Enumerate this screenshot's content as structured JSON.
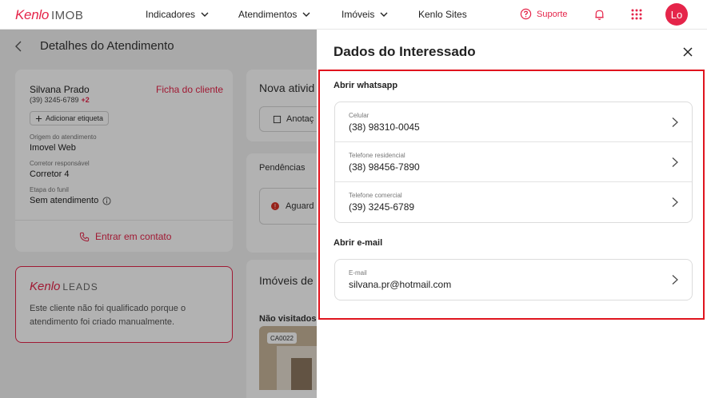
{
  "app": {
    "logo_brand": "Kenlo",
    "logo_suffix": "IMOB",
    "nav": [
      {
        "label": "Indicadores"
      },
      {
        "label": "Atendimentos"
      },
      {
        "label": "Imóveis"
      },
      {
        "label": "Kenlo Sites"
      }
    ],
    "support_label": "Suporte",
    "avatar_initials": "Lo",
    "accent_color": "#e5254a"
  },
  "background": {
    "page_title": "Detalhes do Atendimento",
    "client": {
      "name": "Silvana Prado",
      "phone": "(39) 3245-6789",
      "more_phones": "+2",
      "profile_link": "Ficha do cliente",
      "add_tag": "Adicionar etiqueta",
      "fields": [
        {
          "label": "Origem do atendimento",
          "value": "Imovel Web"
        },
        {
          "label": "Corretor responsável",
          "value": "Corretor 4"
        },
        {
          "label": "Etapa do funil",
          "value": "Sem atendimento"
        }
      ],
      "contact_button": "Entrar em contato"
    },
    "leads": {
      "logo_brand": "Kenlo",
      "logo_suffix": "LEADS",
      "message": "Este cliente não foi qualificado porque o atendimento foi criado manualmente."
    },
    "activity": {
      "title": "Nova ativid",
      "button": "Anotaç"
    },
    "pendencies": {
      "title": "Pendências",
      "item": "Aguard"
    },
    "properties": {
      "title": "Imóveis de",
      "subtitle": "Não visitados",
      "code": "CA0022"
    }
  },
  "drawer": {
    "title": "Dados do Interessado",
    "whatsapp_section": "Abrir whatsapp",
    "whatsapp_contacts": [
      {
        "label": "Celular",
        "value": "(38) 98310-0045"
      },
      {
        "label": "Telefone residencial",
        "value": "(38) 98456-7890"
      },
      {
        "label": "Telefone comercial",
        "value": "(39) 3245-6789"
      }
    ],
    "email_section": "Abrir e-mail",
    "email_contacts": [
      {
        "label": "E-mail",
        "value": "silvana.pr@hotmail.com"
      }
    ]
  }
}
